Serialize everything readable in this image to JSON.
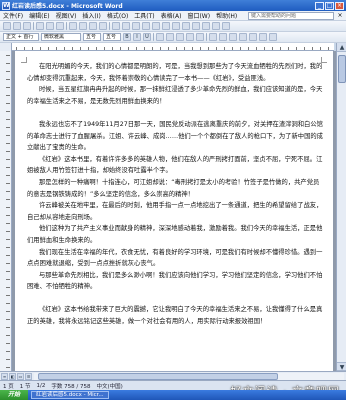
{
  "window": {
    "title": "红岩读后感5.docx - Microsoft Word",
    "app_icon": "W",
    "buttons": [
      "_",
      "□",
      "×"
    ]
  },
  "menubar": {
    "items": [
      "文件(F)",
      "编辑(E)",
      "视图(V)",
      "插入(I)",
      "格式(O)",
      "工具(T)",
      "表格(A)",
      "窗口(W)",
      "帮助(H)"
    ],
    "help_placeholder": "键入需要帮助的问题",
    "help_close": "×"
  },
  "toolbar": {
    "style_combo": "正文 + 首行",
    "font_combo": "微软雅黑",
    "size_combo": "五号",
    "font2_combo": "五号",
    "bold": "B",
    "italic": "I",
    "underline": "U"
  },
  "document": {
    "paragraphs": [
      "在阳光明媚的今天，我们的心情都是明朗的，可是，当我想到那些为了今天流血牺牲的先烈们时，我的心情却变得沉重起来，今天，我怀着崇敬的心情读完了一本书——《红岩》，受益匪浅。",
      "时候，当五星红旗冉冉升起的时候，那一抹鲜红浸透了多少革命先烈的鲜血，我们应该知道的是，今天的幸福生活来之不易，是无数先烈用鲜血换来的！",
      "",
      "我永远也忘不了1949年11月27日那一天，国民党反动派在逃离重庆的前夕，对关押在渣滓洞和白公馆的革命志士进行了血腥屠杀。江姐、许云峰、成岗……他们一个个都倒在了敌人的枪口下，为了新中国的成立献出了宝贵的生命。",
      "《红岩》这本书里，有着许许多多的英雄人物，他们在敌人的严刑拷打面前，坚贞不屈，宁死不屈。江姐被敌人用竹签钉进十指，却始终没有吐露半个字。",
      "那是怎样的一种痛啊！十指连心，可江姐却说：“毒刑拷打是太小的考验！竹签子是竹做的，共产党员的意志是钢铁铸成的！”多么坚定的信念，多么崇高的精神！",
      "许云峰被关在地牢里，在最后的时刻，他用手指一点一点地挖出了一条通道，把生的希望留给了战友，自己却从容地走向刑场。",
      "他们这种为了共产主义事业而献身的精神，深深地感动着我，激励着我。我们今天的幸福生活，正是他们用鲜血和生命换来的。",
      "我们现在生活在幸福的年代，衣食无忧，有着良好的学习环境，可是我们有时候却不懂得珍惜。遇到一点点困难就退缩，受到一点点挫折就灰心丧气。",
      "与那些革命先烈相比，我们是多么渺小啊！我们应该向他们学习，学习他们坚定的信念，学习他们不怕困难、不怕牺牲的精神。",
      "",
      "《红岩》这本书给我带来了巨大的震撼，它让我明白了今天的幸福生活来之不易，让我懂得了什么是真正的英雄，我将永远铭记这些英雄，做一个对社会有用的人，用实际行动来报效祖国！"
    ]
  },
  "statusbar": {
    "page": "1 页",
    "section": "1 节",
    "position": "1/2",
    "words": "字数 758 / 758",
    "language": "中文(中国)"
  },
  "taskbar": {
    "start": "开始",
    "task": "红岩读后感5.docx - Micr..."
  },
  "watermark": "好文阅读 · 文章吧网"
}
